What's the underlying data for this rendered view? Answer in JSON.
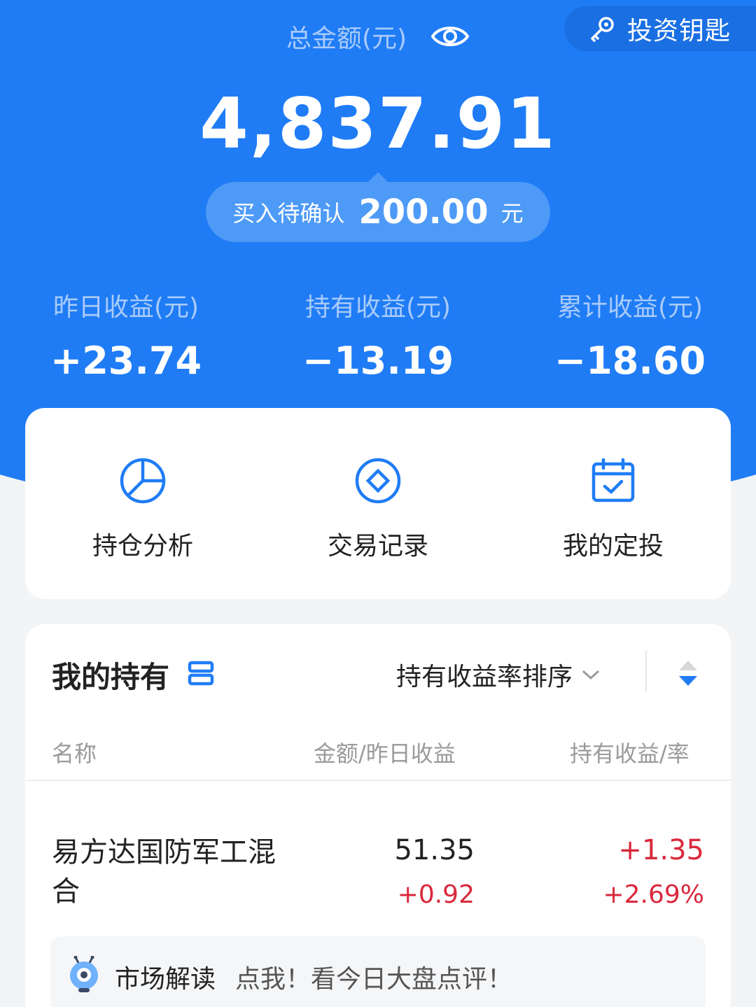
{
  "header": {
    "key_button_label": "投资钥匙",
    "total_label": "总金额(元)",
    "total_amount": "4,837.91",
    "pending": {
      "label": "买入待确认",
      "amount": "200.00",
      "unit": "元"
    }
  },
  "stats": [
    {
      "label": "昨日收益(元)",
      "value": "+23.74"
    },
    {
      "label": "持有收益(元)",
      "value": "−13.19"
    },
    {
      "label": "累计收益(元)",
      "value": "−18.60"
    }
  ],
  "actions": [
    {
      "label": "持仓分析",
      "icon": "pie-chart-icon"
    },
    {
      "label": "交易记录",
      "icon": "coin-icon"
    },
    {
      "label": "我的定投",
      "icon": "calendar-check-icon"
    }
  ],
  "holdings": {
    "title": "我的持有",
    "sort_label": "持有收益率排序",
    "columns": [
      "名称",
      "金额/昨日收益",
      "持有收益/率"
    ],
    "funds": [
      {
        "name": "易方达国防军工混合",
        "amount": "51.35",
        "yesterday": "+0.92",
        "hold_profit": "+1.35",
        "hold_rate": "+2.69%"
      }
    ]
  },
  "market": {
    "title": "市场解读",
    "desc": "点我！看今日大盘点评！"
  },
  "colors": {
    "brand_blue": "#1f7cf5",
    "profit_red": "#d9283b"
  }
}
